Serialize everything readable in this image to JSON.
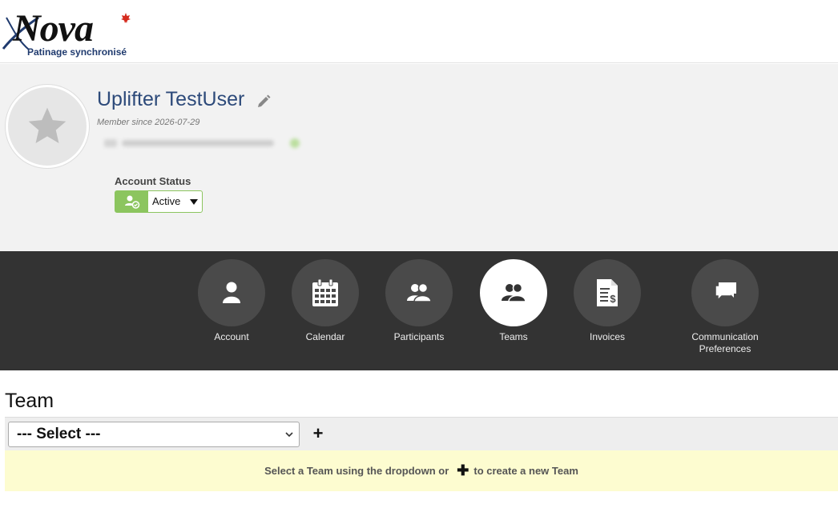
{
  "logo": {
    "wordmark": "Nova",
    "subtitle": "Patinage synchronisé"
  },
  "profile": {
    "name": "Uplifter TestUser",
    "member_since": "Member since 2026-07-29",
    "account_status_label": "Account Status",
    "account_status_value": "Active"
  },
  "nav": {
    "items": [
      {
        "label": "Account",
        "icon": "user-icon"
      },
      {
        "label": "Calendar",
        "icon": "calendar-icon"
      },
      {
        "label": "Participants",
        "icon": "participants-icon"
      },
      {
        "label": "Teams",
        "icon": "teams-icon",
        "active": true
      },
      {
        "label": "Invoices",
        "icon": "invoice-icon"
      },
      {
        "label": "Communication Preferences",
        "icon": "chat-icon"
      }
    ]
  },
  "team": {
    "title": "Team",
    "select_value": "--- Select ---",
    "add_label": "+",
    "hint_before": "Select a Team using the dropdown or",
    "hint_after": "to create a new Team"
  },
  "colors": {
    "accent_green": "#8cc55f",
    "nav_bg": "#333333",
    "title_blue": "#2d4a7a",
    "hint_bg": "#fdfcd0"
  }
}
